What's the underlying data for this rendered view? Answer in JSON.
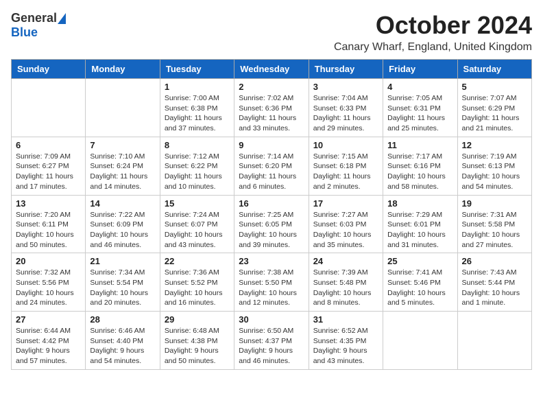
{
  "logo": {
    "general": "General",
    "blue": "Blue"
  },
  "title": "October 2024",
  "location": "Canary Wharf, England, United Kingdom",
  "days_of_week": [
    "Sunday",
    "Monday",
    "Tuesday",
    "Wednesday",
    "Thursday",
    "Friday",
    "Saturday"
  ],
  "weeks": [
    [
      {
        "day": "",
        "info": ""
      },
      {
        "day": "",
        "info": ""
      },
      {
        "day": "1",
        "info": "Sunrise: 7:00 AM\nSunset: 6:38 PM\nDaylight: 11 hours and 37 minutes."
      },
      {
        "day": "2",
        "info": "Sunrise: 7:02 AM\nSunset: 6:36 PM\nDaylight: 11 hours and 33 minutes."
      },
      {
        "day": "3",
        "info": "Sunrise: 7:04 AM\nSunset: 6:33 PM\nDaylight: 11 hours and 29 minutes."
      },
      {
        "day": "4",
        "info": "Sunrise: 7:05 AM\nSunset: 6:31 PM\nDaylight: 11 hours and 25 minutes."
      },
      {
        "day": "5",
        "info": "Sunrise: 7:07 AM\nSunset: 6:29 PM\nDaylight: 11 hours and 21 minutes."
      }
    ],
    [
      {
        "day": "6",
        "info": "Sunrise: 7:09 AM\nSunset: 6:27 PM\nDaylight: 11 hours and 17 minutes."
      },
      {
        "day": "7",
        "info": "Sunrise: 7:10 AM\nSunset: 6:24 PM\nDaylight: 11 hours and 14 minutes."
      },
      {
        "day": "8",
        "info": "Sunrise: 7:12 AM\nSunset: 6:22 PM\nDaylight: 11 hours and 10 minutes."
      },
      {
        "day": "9",
        "info": "Sunrise: 7:14 AM\nSunset: 6:20 PM\nDaylight: 11 hours and 6 minutes."
      },
      {
        "day": "10",
        "info": "Sunrise: 7:15 AM\nSunset: 6:18 PM\nDaylight: 11 hours and 2 minutes."
      },
      {
        "day": "11",
        "info": "Sunrise: 7:17 AM\nSunset: 6:16 PM\nDaylight: 10 hours and 58 minutes."
      },
      {
        "day": "12",
        "info": "Sunrise: 7:19 AM\nSunset: 6:13 PM\nDaylight: 10 hours and 54 minutes."
      }
    ],
    [
      {
        "day": "13",
        "info": "Sunrise: 7:20 AM\nSunset: 6:11 PM\nDaylight: 10 hours and 50 minutes."
      },
      {
        "day": "14",
        "info": "Sunrise: 7:22 AM\nSunset: 6:09 PM\nDaylight: 10 hours and 46 minutes."
      },
      {
        "day": "15",
        "info": "Sunrise: 7:24 AM\nSunset: 6:07 PM\nDaylight: 10 hours and 43 minutes."
      },
      {
        "day": "16",
        "info": "Sunrise: 7:25 AM\nSunset: 6:05 PM\nDaylight: 10 hours and 39 minutes."
      },
      {
        "day": "17",
        "info": "Sunrise: 7:27 AM\nSunset: 6:03 PM\nDaylight: 10 hours and 35 minutes."
      },
      {
        "day": "18",
        "info": "Sunrise: 7:29 AM\nSunset: 6:01 PM\nDaylight: 10 hours and 31 minutes."
      },
      {
        "day": "19",
        "info": "Sunrise: 7:31 AM\nSunset: 5:58 PM\nDaylight: 10 hours and 27 minutes."
      }
    ],
    [
      {
        "day": "20",
        "info": "Sunrise: 7:32 AM\nSunset: 5:56 PM\nDaylight: 10 hours and 24 minutes."
      },
      {
        "day": "21",
        "info": "Sunrise: 7:34 AM\nSunset: 5:54 PM\nDaylight: 10 hours and 20 minutes."
      },
      {
        "day": "22",
        "info": "Sunrise: 7:36 AM\nSunset: 5:52 PM\nDaylight: 10 hours and 16 minutes."
      },
      {
        "day": "23",
        "info": "Sunrise: 7:38 AM\nSunset: 5:50 PM\nDaylight: 10 hours and 12 minutes."
      },
      {
        "day": "24",
        "info": "Sunrise: 7:39 AM\nSunset: 5:48 PM\nDaylight: 10 hours and 8 minutes."
      },
      {
        "day": "25",
        "info": "Sunrise: 7:41 AM\nSunset: 5:46 PM\nDaylight: 10 hours and 5 minutes."
      },
      {
        "day": "26",
        "info": "Sunrise: 7:43 AM\nSunset: 5:44 PM\nDaylight: 10 hours and 1 minute."
      }
    ],
    [
      {
        "day": "27",
        "info": "Sunrise: 6:44 AM\nSunset: 4:42 PM\nDaylight: 9 hours and 57 minutes."
      },
      {
        "day": "28",
        "info": "Sunrise: 6:46 AM\nSunset: 4:40 PM\nDaylight: 9 hours and 54 minutes."
      },
      {
        "day": "29",
        "info": "Sunrise: 6:48 AM\nSunset: 4:38 PM\nDaylight: 9 hours and 50 minutes."
      },
      {
        "day": "30",
        "info": "Sunrise: 6:50 AM\nSunset: 4:37 PM\nDaylight: 9 hours and 46 minutes."
      },
      {
        "day": "31",
        "info": "Sunrise: 6:52 AM\nSunset: 4:35 PM\nDaylight: 9 hours and 43 minutes."
      },
      {
        "day": "",
        "info": ""
      },
      {
        "day": "",
        "info": ""
      }
    ]
  ]
}
